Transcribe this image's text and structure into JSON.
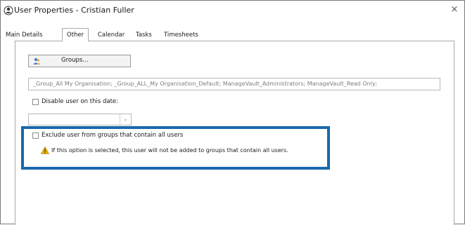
{
  "window": {
    "title": "User Properties - Cristian Fuller",
    "close_glyph": "×"
  },
  "tabs": [
    {
      "label": "Main Details",
      "active": false
    },
    {
      "label": "Other",
      "active": true
    },
    {
      "label": "Calendar",
      "active": false
    },
    {
      "label": "Tasks",
      "active": false
    },
    {
      "label": "Timesheets",
      "active": false
    }
  ],
  "groups": {
    "button_label": "Groups...",
    "icon": "user-group-icon",
    "value": "_Group_All My Organisation; _Group_ALL_My Organisation_Default; ManageVault_Administrators; ManageVault_Read Only;"
  },
  "disable_user": {
    "label": "Disable user on this date:",
    "checked": false,
    "date_value": "",
    "dropdown_glyph": "⌄"
  },
  "exclude_groups": {
    "label": "Exclude user from groups that contain all users",
    "checked": false,
    "warning_text": "If this option is selected, this user will not be added to groups that contain all users.",
    "warning_icon": "warning-icon"
  },
  "colors": {
    "highlight": "#1a68ad",
    "warning": "#e8b400"
  }
}
